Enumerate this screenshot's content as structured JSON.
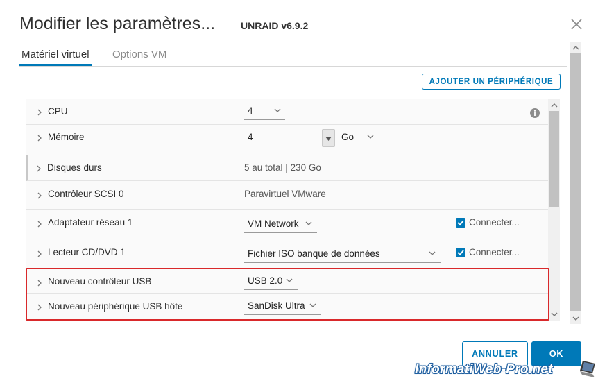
{
  "dialog": {
    "title": "Modifier les paramètres...",
    "vm_name": "UNRAID v6.9.2"
  },
  "tabs": [
    {
      "label": "Matériel virtuel",
      "active": true
    },
    {
      "label": "Options VM",
      "active": false
    }
  ],
  "toolbar": {
    "add_device_label": "AJOUTER UN PÉRIPHÉRIQUE"
  },
  "hardware": {
    "cpu": {
      "label": "CPU",
      "value": "4"
    },
    "memory": {
      "label": "Mémoire",
      "value": "4",
      "unit": "Go"
    },
    "disks": {
      "label": "Disques durs",
      "value": "5 au total | 230 Go"
    },
    "scsi": {
      "label": "Contrôleur SCSI 0",
      "value": "Paravirtuel VMware"
    },
    "network": {
      "label": "Adaptateur réseau 1",
      "value": "VM Network",
      "connect_label": "Connecter...",
      "connected": true
    },
    "cdrom": {
      "label": "Lecteur CD/DVD 1",
      "value": "Fichier ISO banque de données",
      "connect_label": "Connecter...",
      "connected": true
    },
    "usb_controller": {
      "label": "Nouveau contrôleur USB",
      "value": "USB 2.0"
    },
    "usb_device": {
      "label": "Nouveau périphérique USB hôte",
      "value": "SanDisk Ultra"
    }
  },
  "footer": {
    "cancel_label": "ANNULER",
    "ok_label": "OK"
  },
  "watermark": {
    "text": "InformatiWeb-Pro.net"
  },
  "colors": {
    "accent": "#0079b8",
    "highlight": "#d9292b"
  }
}
